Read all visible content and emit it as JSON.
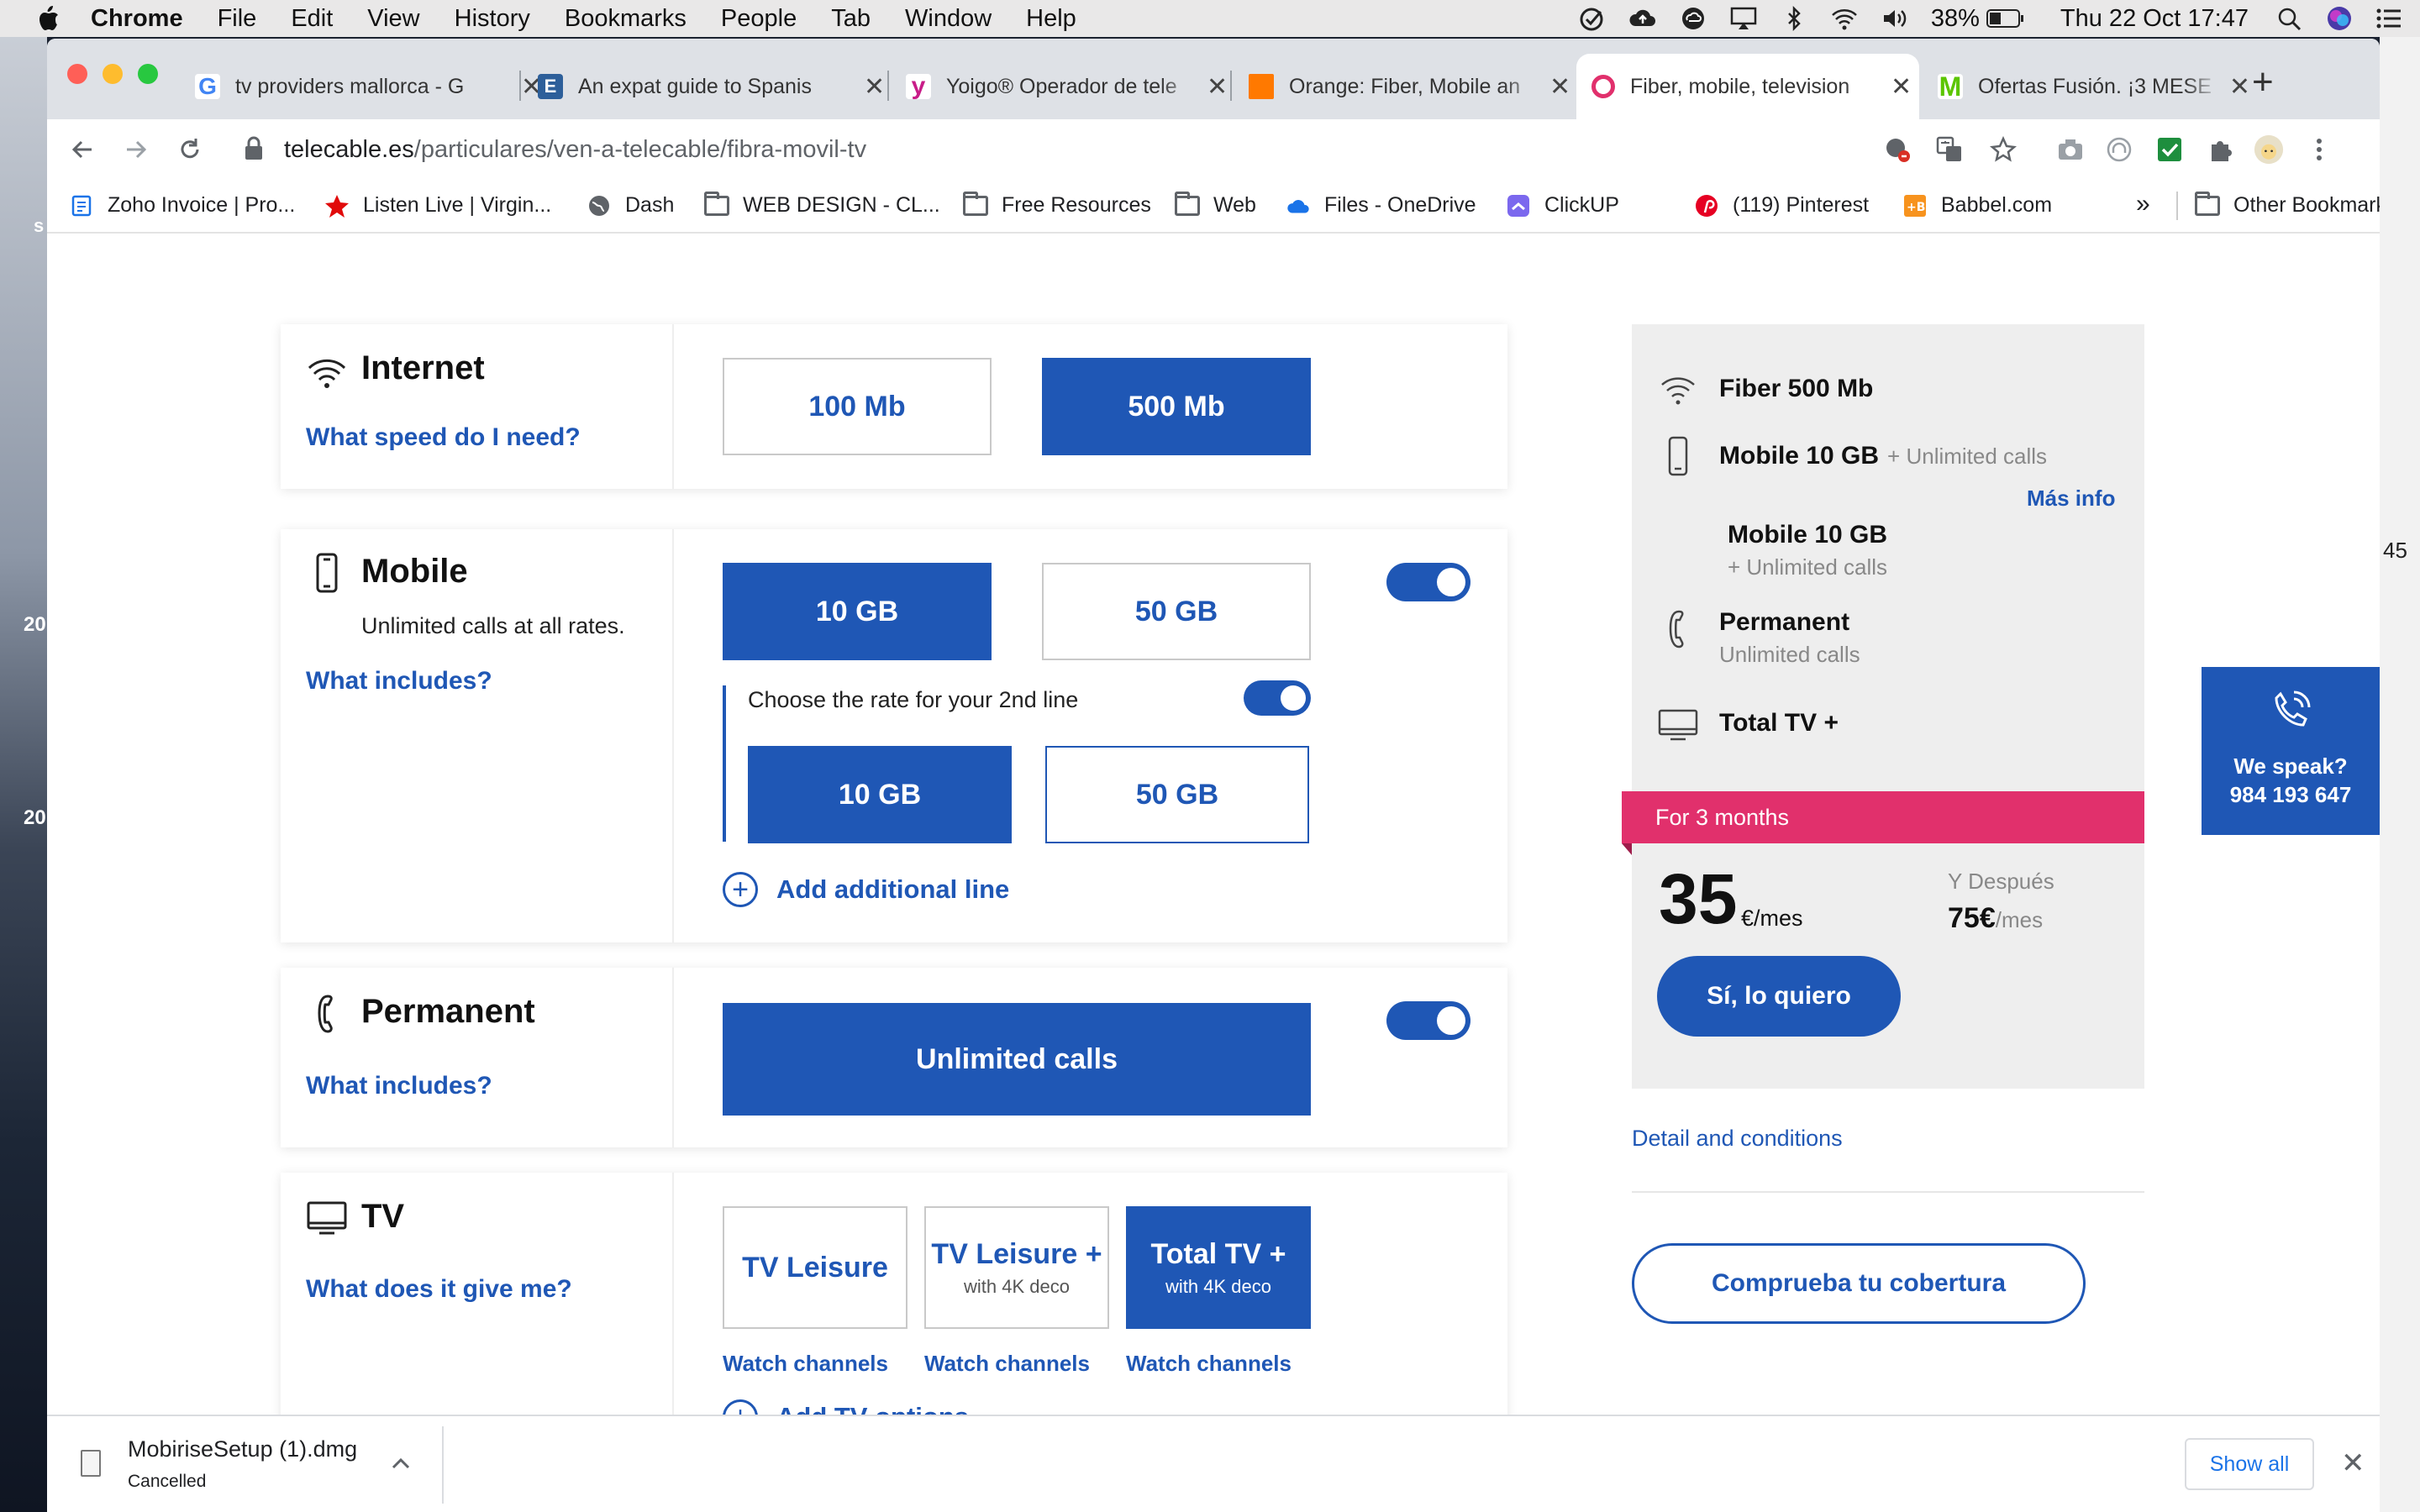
{
  "menubar": {
    "app": "Chrome",
    "items": [
      "File",
      "Edit",
      "View",
      "History",
      "Bookmarks",
      "People",
      "Tab",
      "Window",
      "Help"
    ],
    "battery": "38%",
    "datetime": "Thu 22 Oct  17:47"
  },
  "desktop": {
    "left_labels": [
      "s",
      "20",
      "20"
    ],
    "right_label": "45"
  },
  "tabs": [
    {
      "title": "tv providers mallorca - G",
      "favicon": "google-icon",
      "color": "#4285f4",
      "glyph": "G"
    },
    {
      "title": "An expat guide to Spanis",
      "favicon": "e-icon",
      "color": "#2d5f9a",
      "glyph": "E"
    },
    {
      "title": "Yoigo® Operador de tele",
      "favicon": "yoigo-icon",
      "color": "#c81c88",
      "glyph": "y"
    },
    {
      "title": "Orange: Fiber, Mobile an",
      "favicon": "orange-icon",
      "color": "#ff7900",
      "glyph": ""
    },
    {
      "title": "Fiber, mobile, television",
      "favicon": "telecable-icon",
      "color": "#e1306c",
      "glyph": ""
    },
    {
      "title": "Ofertas Fusión. ¡3 MESE",
      "favicon": "movistar-icon",
      "color": "#5bc500",
      "glyph": "M"
    }
  ],
  "url": {
    "host": "telecable.es",
    "path": "/particulares/ven-a-telecable/fibra-movil-tv"
  },
  "bookmarks": [
    "Zoho Invoice | Pro...",
    "Listen Live | Virgin...",
    "Dash",
    "WEB DESIGN - CL...",
    "Free Resources",
    "Web",
    "Files - OneDrive",
    "ClickUP",
    "(119) Pinterest",
    "Babbel.com"
  ],
  "bookmarks_more": "»",
  "bookmarks_other": "Other Bookmarks",
  "internet": {
    "title": "Internet",
    "link": "What speed do I need?",
    "options": [
      "100 Mb",
      "500 Mb"
    ],
    "selected": "500 Mb"
  },
  "mobile": {
    "title": "Mobile",
    "subtitle": "Unlimited calls at all rates.",
    "link": "What includes?",
    "options": [
      "10 GB",
      "50 GB"
    ],
    "selected": "10 GB",
    "enabled": true,
    "second_line_label": "Choose the rate for your 2nd line",
    "second_line_options": [
      "10 GB",
      "50 GB"
    ],
    "second_line_selected": "10 GB",
    "second_line_enabled": true,
    "add_line": "Add additional line"
  },
  "permanent": {
    "title": "Permanent",
    "link": "What includes?",
    "option": "Unlimited calls",
    "enabled": true
  },
  "tv": {
    "title": "TV",
    "link": "What does it give me?",
    "options": [
      {
        "name": "TV Leisure",
        "sub": ""
      },
      {
        "name": "TV Leisure +",
        "sub": "with 4K deco"
      },
      {
        "name": "Total TV +",
        "sub": "with 4K deco"
      }
    ],
    "selected": "Total TV +",
    "watch": "Watch channels",
    "add_options": "Add TV options"
  },
  "summary": {
    "fiber": "Fiber 500 Mb",
    "mobile": "Mobile 10 GB",
    "mobile_extra": "+ Unlimited calls",
    "more_info": "Más info",
    "mobile2": "Mobile 10 GB",
    "mobile2_extra": "+ Unlimited calls",
    "permanent": "Permanent",
    "permanent_extra": "Unlimited calls",
    "tv": "Total TV +",
    "promo": "For 3 months",
    "price": "35",
    "price_unit": "€/mes",
    "after_label": "Y Después",
    "after_price": "75€",
    "after_unit": "/mes",
    "cta": "Sí, lo quiero",
    "conditions": "Detail and conditions",
    "coverage": "Comprueba tu cobertura"
  },
  "speak": {
    "label": "We speak?",
    "phone": "984 193 647"
  },
  "download": {
    "file": "MobiriseSetup (1).dmg",
    "status": "Cancelled",
    "show_all": "Show all"
  },
  "colors": {
    "brand_blue": "#1f57b5",
    "promo_pink": "#e1306c",
    "panel_grey": "#eeeeee"
  }
}
